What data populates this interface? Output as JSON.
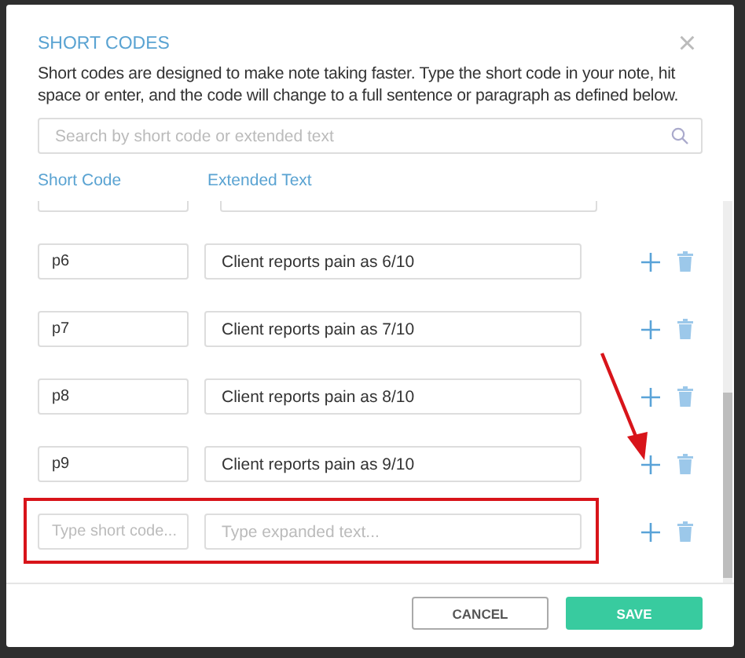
{
  "dialog": {
    "title": "SHORT CODES",
    "close": "×",
    "description": "Short codes are designed to make note taking faster. Type the short code in your note, hit space or enter, and the code will change to a full sentence or paragraph as defined below."
  },
  "search": {
    "placeholder": "Search by short code or extended text"
  },
  "columns": [
    "Short Code",
    "Extended Text"
  ],
  "entries": [
    {
      "code": "p6",
      "text": "Client reports pain as 6/10"
    },
    {
      "code": "p7",
      "text": "Client reports pain as 7/10"
    },
    {
      "code": "p8",
      "text": "Client reports pain as 8/10"
    },
    {
      "code": "p9",
      "text": "Client reports pain as 9/10"
    }
  ],
  "new_entry": {
    "code_field": {
      "placeholder": "Type short code..."
    },
    "text_field": {
      "placeholder": "Type expanded text..."
    }
  },
  "buttons": [
    {
      "label": "CANCEL",
      "kind": "secondary"
    },
    {
      "label": "SAVE",
      "kind": "primary"
    }
  ]
}
